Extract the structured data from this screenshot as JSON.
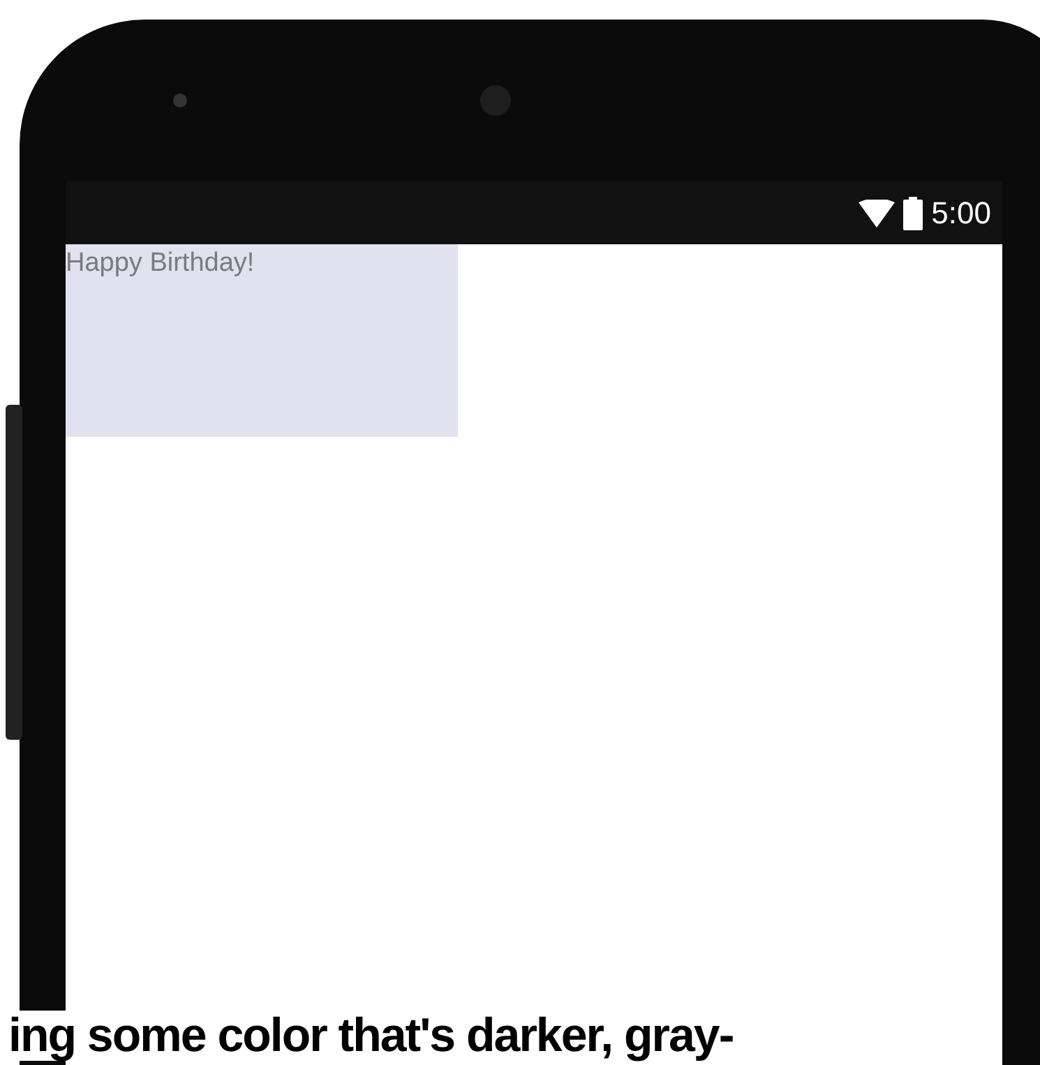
{
  "status_bar": {
    "time": "5:00"
  },
  "screen": {
    "text_view": {
      "text": "Happy Birthday!"
    }
  },
  "caption": {
    "text": "ing some color that's darker, gray-"
  }
}
